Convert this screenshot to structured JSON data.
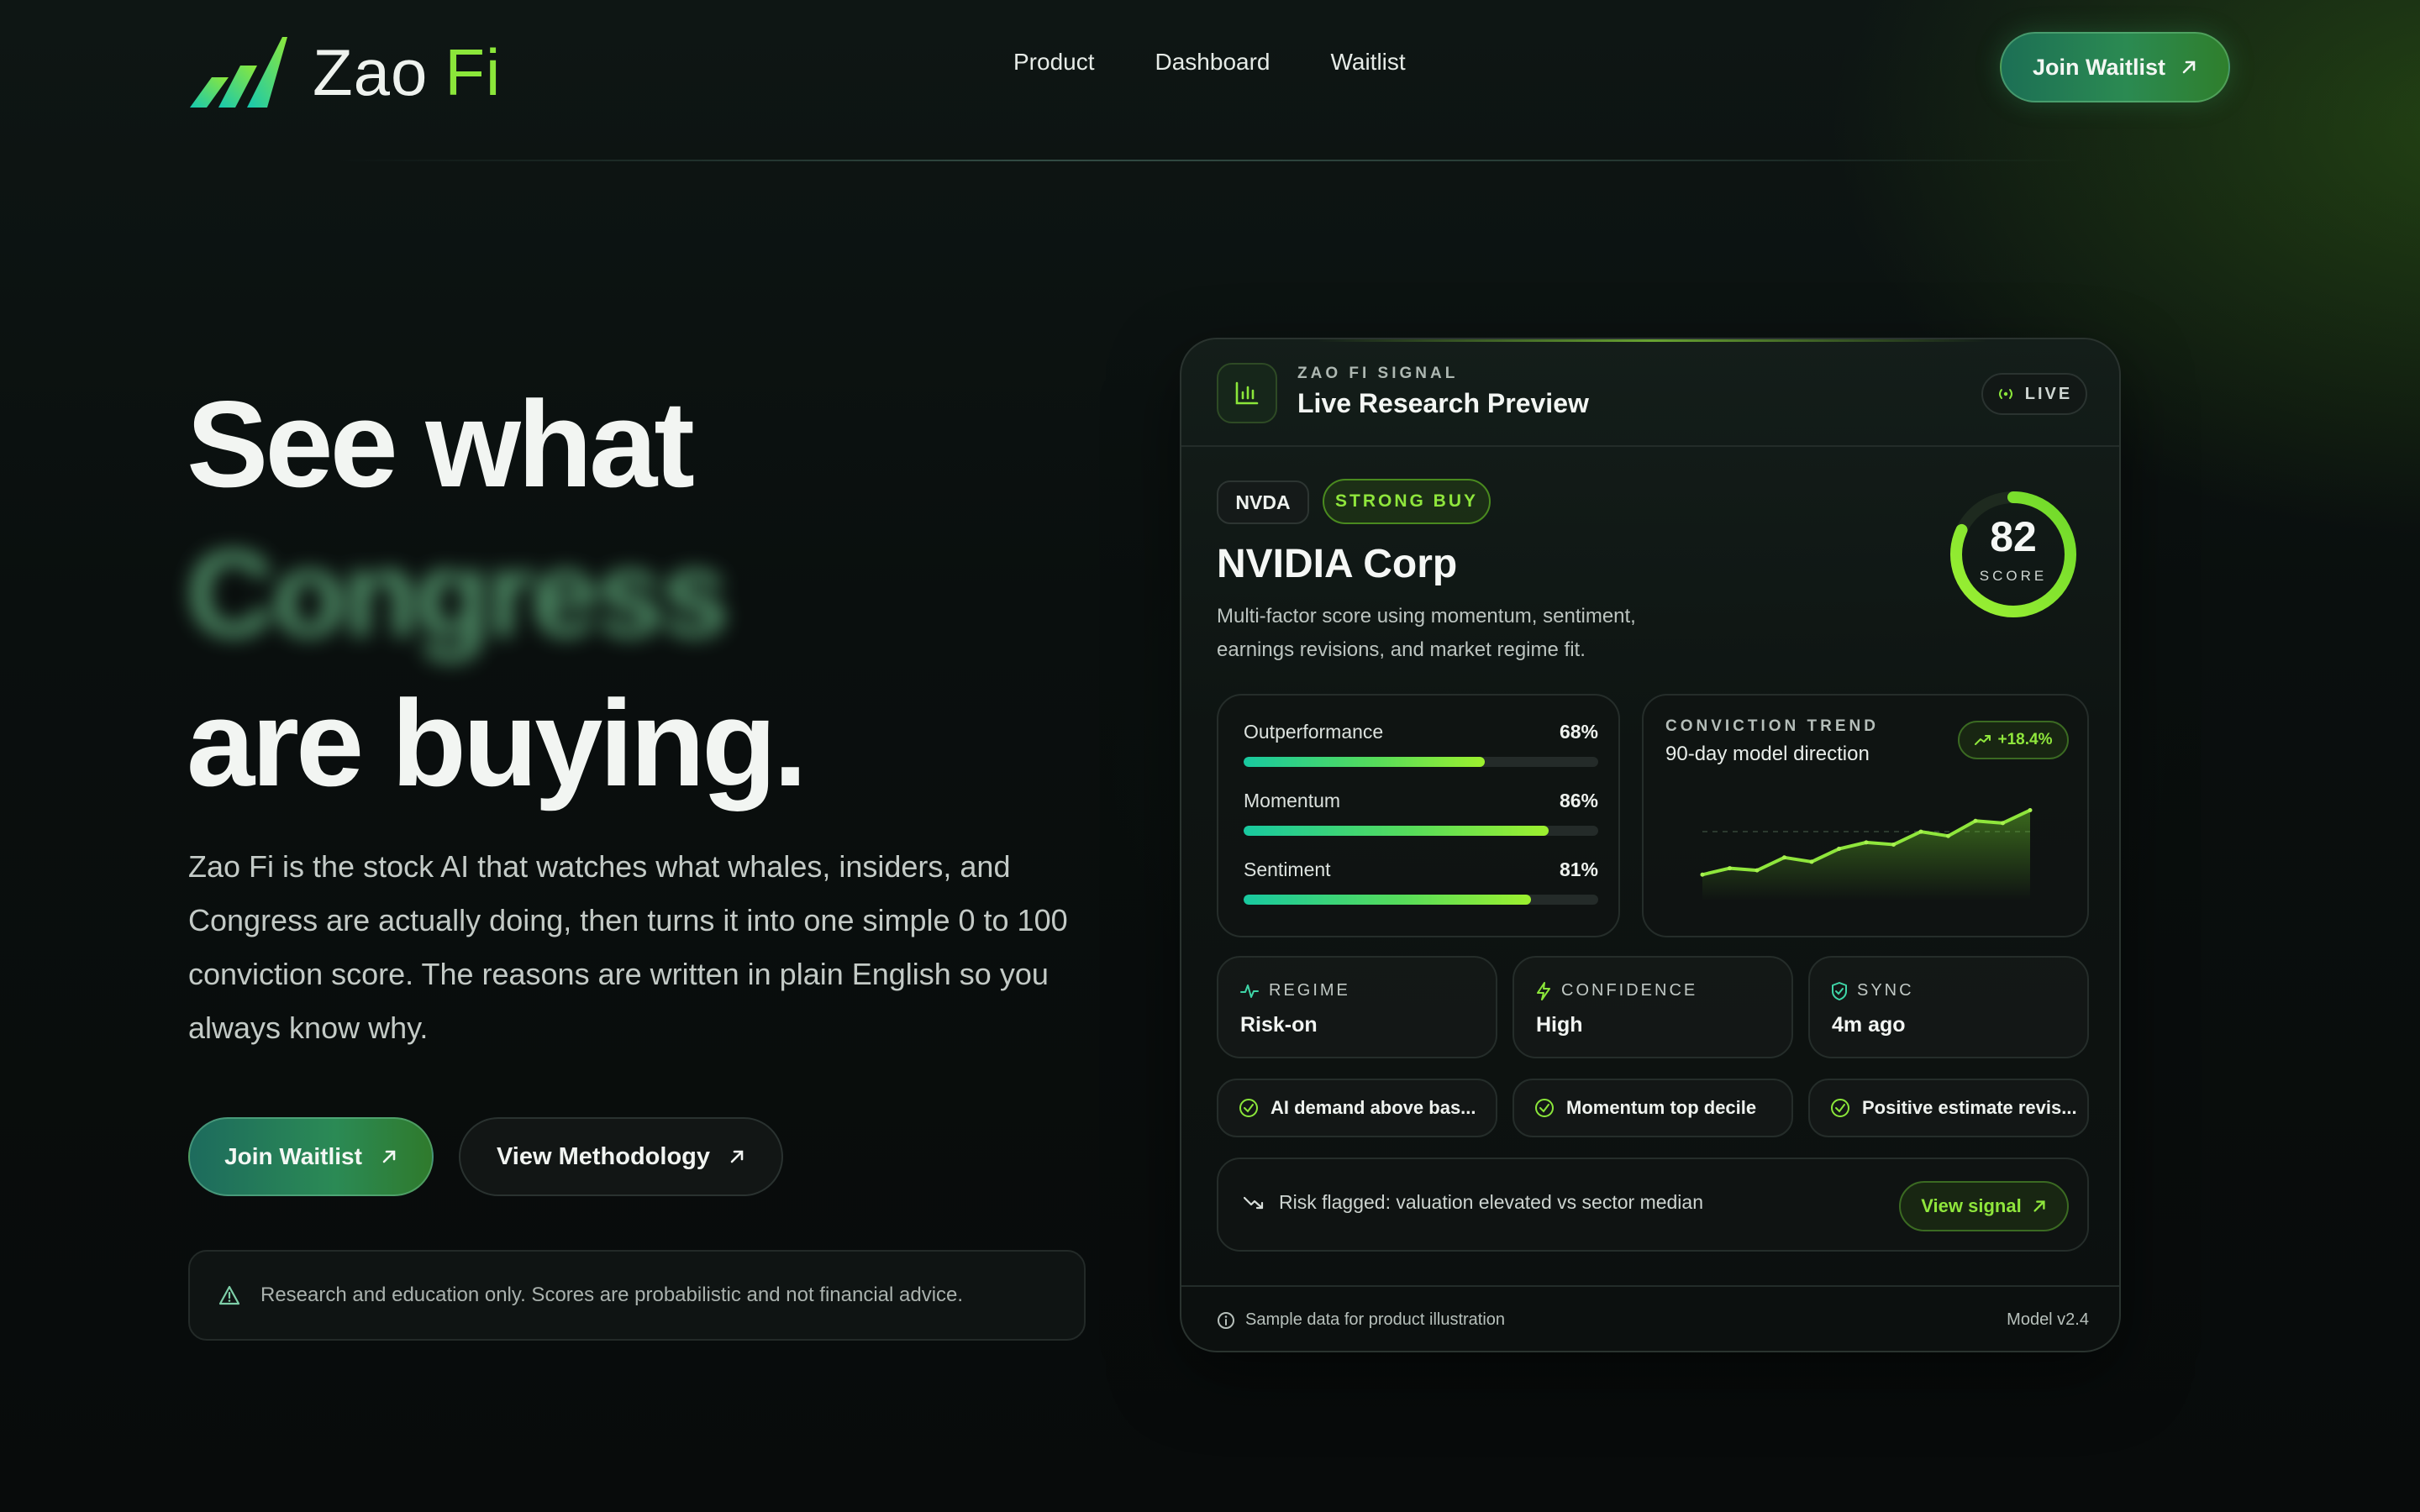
{
  "brand": {
    "name": "Zao",
    "accent_word": "Fi",
    "accent_color": "#8be63a"
  },
  "nav": {
    "links": [
      "Product",
      "Dashboard",
      "Waitlist"
    ],
    "cta_label": "Join Waitlist"
  },
  "hero": {
    "title_line1": "See what",
    "title_blurred": "Congress",
    "title_line3": "are buying.",
    "description": "Zao Fi is the stock AI that watches what whales, insiders, and Congress are actually doing, then turns it into one simple 0 to 100 conviction score. The reasons are written in plain English so you always know why.",
    "primary_button": "Join Waitlist",
    "secondary_button": "View Methodology",
    "disclaimer": "Research and education only. Scores are probabilistic and not financial advice."
  },
  "card": {
    "eyebrow": "ZAO FI SIGNAL",
    "title": "Live Research Preview",
    "live_label": "LIVE",
    "ticker": "NVDA",
    "signal": "STRONG BUY",
    "company": "NVIDIA Corp",
    "company_desc": "Multi-factor score using momentum, sentiment, earnings revisions, and market regime fit.",
    "score": {
      "value": 82,
      "label": "SCORE",
      "max": 100
    },
    "metrics": [
      {
        "label": "Outperformance",
        "value": 68,
        "display": "68%"
      },
      {
        "label": "Momentum",
        "value": 86,
        "display": "86%"
      },
      {
        "label": "Sentiment",
        "value": 81,
        "display": "81%"
      }
    ],
    "trend": {
      "eyebrow": "CONVICTION TREND",
      "title": "90-day model direction",
      "change": "+18.4%"
    },
    "stats": [
      {
        "label": "REGIME",
        "value": "Risk-on",
        "icon": "pulse-icon"
      },
      {
        "label": "CONFIDENCE",
        "value": "High",
        "icon": "bolt-icon"
      },
      {
        "label": "SYNC",
        "value": "4m ago",
        "icon": "shield-icon"
      }
    ],
    "reasons": [
      "AI demand above bas...",
      "Momentum top decile",
      "Positive estimate revis..."
    ],
    "risk": "Risk flagged: valuation elevated vs sector median",
    "signal_button": "View signal",
    "footer_note": "Sample data for product illustration",
    "model_version": "Model v2.4"
  },
  "chart_data": {
    "type": "line",
    "title": "",
    "series": [
      {
        "values": [
          42,
          45,
          44,
          50,
          48,
          54,
          57,
          56,
          62,
          60,
          67,
          66,
          72
        ]
      }
    ],
    "ylim": [
      30,
      80
    ],
    "grid": false
  }
}
